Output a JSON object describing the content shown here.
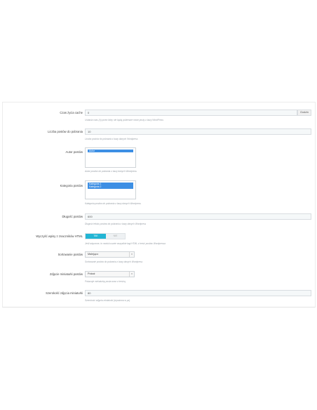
{
  "fields": {
    "cache": {
      "label": "Czas życia cache",
      "value": "0",
      "addon": "Godzin",
      "help": "Ustawia czas (h) przez który nie będą pobierane nowe posty z bazy WordPress"
    },
    "count": {
      "label": "Liczba postów do pobrania",
      "value": "10",
      "help": "Liczba postów do pobrania z bazy danych Wordpress"
    },
    "author": {
      "label": "Autor postów",
      "options": [
        "Autor"
      ],
      "help": "Autor postów do pobrania z bazy danych Wordpress"
    },
    "category": {
      "label": "Kategoria postów",
      "options": [
        "Kategoria 1",
        "Kategoria 2"
      ],
      "help": "Kategoria postów do pobrania z bazy danych Wordpress"
    },
    "length": {
      "label": "Długość postów",
      "value": "600",
      "help": "Długość tekstu postów do pobrania z bazy danych Wordpress"
    },
    "html": {
      "label": "Wyczyść wpisy z znaczników HTML",
      "on": "TAK",
      "off": "NIE",
      "help": "Jeśli włączone, to moduł usunie wszystkie tagi HTML z treści postów Wordpressa"
    },
    "sort": {
      "label": "Sortowanie postów",
      "value": "Malejąco",
      "help": "Sortowanie postów do pobrania z bazy danych Wordpress"
    },
    "thumb": {
      "label": "Zdjęcie miniaturki postów",
      "value": "Pokaż",
      "help": "Pokazuje miniaturkę posta wraz z treścią"
    },
    "thumbwidth": {
      "label": "Szerokość zdjęcia miniaturki",
      "value": "80",
      "help": "Szerokość zdjęcia miniaturki (wyrażona w px)"
    }
  },
  "icons": {
    "select_arrow": "chevron-down-icon"
  },
  "colors": {
    "switch_on": "#22b5d4",
    "selected_option": "#3d8fe4"
  }
}
